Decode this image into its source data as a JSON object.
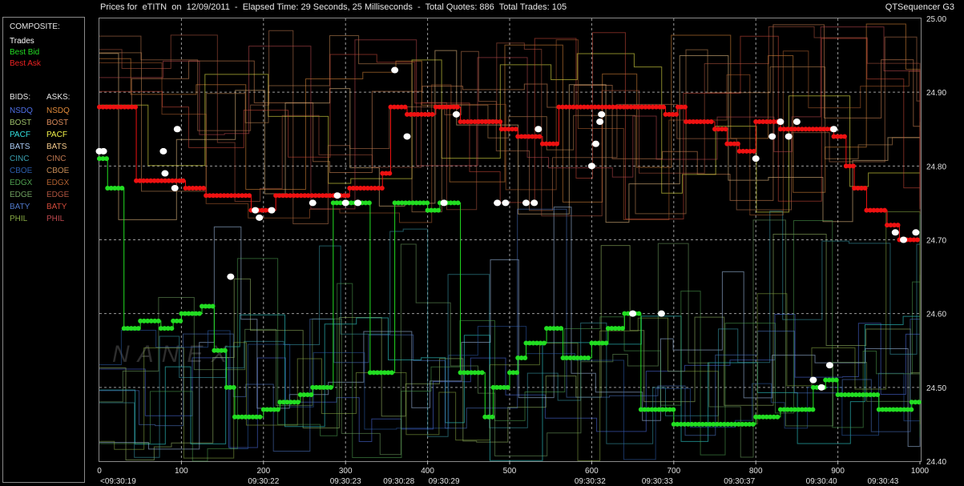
{
  "header": {
    "title": "Prices for  eTITN  on  12/09/2011  -  Elapsed Time: 29 Seconds, 25 Milliseconds  -  Total Quotes: 886  Total Trades: 105",
    "app_name": "QTSequencer G3"
  },
  "legend": {
    "composite_label": "COMPOSITE:",
    "trades_label": "Trades",
    "best_bid_label": "Best Bid",
    "best_ask_label": "Best Ask",
    "bids_header": "BIDS:",
    "asks_header": "ASKS:",
    "exchanges": [
      {
        "name": "NSDQ",
        "bid_color": "#4f6fe6",
        "ask_color": "#e08a3a"
      },
      {
        "name": "BOST",
        "bid_color": "#9cbf6a",
        "ask_color": "#d98a5a"
      },
      {
        "name": "PACF",
        "bid_color": "#33e0e0",
        "ask_color": "#f5f54a"
      },
      {
        "name": "BATS",
        "bid_color": "#a7c7f0",
        "ask_color": "#f4c98a"
      },
      {
        "name": "CINC",
        "bid_color": "#3aa0b0",
        "ask_color": "#c07850"
      },
      {
        "name": "CBOE",
        "bid_color": "#2c5dab",
        "ask_color": "#c48a55"
      },
      {
        "name": "EDGX",
        "bid_color": "#4fa050",
        "ask_color": "#b06030"
      },
      {
        "name": "EDGE",
        "bid_color": "#6fa060",
        "ask_color": "#b05540"
      },
      {
        "name": "BATY",
        "bid_color": "#4f78c8",
        "ask_color": "#d04a3a"
      },
      {
        "name": "PHIL",
        "bid_color": "#88aa44",
        "ask_color": "#c04a50"
      }
    ]
  },
  "colors": {
    "trades": "#ffffff",
    "best_bid": "#22dd22",
    "best_ask": "#ee1111",
    "grid": "#9a9a9a"
  },
  "watermark": "NANEX",
  "chart_data": {
    "type": "scatter",
    "title": "Prices for eTITN on 12/09/2011",
    "xlim": [
      0,
      1000
    ],
    "ylim": [
      24.4,
      25.0
    ],
    "x_ticks": [
      "0",
      "100",
      "200",
      "300",
      "400",
      "500",
      "600",
      "700",
      "800",
      "900",
      "1000"
    ],
    "y_ticks": [
      "25.00",
      "24.90",
      "24.80",
      "24.70",
      "24.60",
      "24.50",
      "24.40"
    ],
    "time_labels": [
      {
        "x": 0,
        "label": "<09:30:19"
      },
      {
        "x": 200,
        "label": "09:30:22"
      },
      {
        "x": 300,
        "label": "09:30:23"
      },
      {
        "x": 365,
        "label": "09:30:28"
      },
      {
        "x": 420,
        "label": "09:30:29"
      },
      {
        "x": 598,
        "label": "09:30:32"
      },
      {
        "x": 680,
        "label": "09:30:33"
      },
      {
        "x": 780,
        "label": "09:30:37"
      },
      {
        "x": 880,
        "label": "09:30:40"
      },
      {
        "x": 955,
        "label": "09:30:43"
      }
    ],
    "best_ask": [
      [
        0,
        24.88
      ],
      [
        45,
        24.88
      ],
      [
        45,
        24.78
      ],
      [
        105,
        24.78
      ],
      [
        105,
        24.77
      ],
      [
        130,
        24.77
      ],
      [
        130,
        24.76
      ],
      [
        185,
        24.76
      ],
      [
        185,
        24.74
      ],
      [
        215,
        24.74
      ],
      [
        215,
        24.76
      ],
      [
        305,
        24.76
      ],
      [
        305,
        24.77
      ],
      [
        345,
        24.77
      ],
      [
        345,
        24.79
      ],
      [
        355,
        24.79
      ],
      [
        355,
        24.88
      ],
      [
        375,
        24.88
      ],
      [
        375,
        24.87
      ],
      [
        410,
        24.87
      ],
      [
        410,
        24.88
      ],
      [
        440,
        24.88
      ],
      [
        440,
        24.86
      ],
      [
        490,
        24.86
      ],
      [
        490,
        24.85
      ],
      [
        510,
        24.85
      ],
      [
        510,
        24.84
      ],
      [
        540,
        24.84
      ],
      [
        540,
        24.83
      ],
      [
        560,
        24.83
      ],
      [
        560,
        24.88
      ],
      [
        690,
        24.88
      ],
      [
        690,
        24.87
      ],
      [
        705,
        24.87
      ],
      [
        705,
        24.88
      ],
      [
        715,
        24.88
      ],
      [
        715,
        24.86
      ],
      [
        750,
        24.86
      ],
      [
        750,
        24.85
      ],
      [
        765,
        24.85
      ],
      [
        765,
        24.83
      ],
      [
        780,
        24.83
      ],
      [
        780,
        24.82
      ],
      [
        800,
        24.82
      ],
      [
        800,
        24.86
      ],
      [
        830,
        24.86
      ],
      [
        830,
        24.85
      ],
      [
        895,
        24.85
      ],
      [
        895,
        24.84
      ],
      [
        910,
        24.84
      ],
      [
        910,
        24.8
      ],
      [
        920,
        24.8
      ],
      [
        920,
        24.77
      ],
      [
        935,
        24.77
      ],
      [
        935,
        24.74
      ],
      [
        960,
        24.74
      ],
      [
        960,
        24.72
      ],
      [
        975,
        24.72
      ],
      [
        975,
        24.7
      ],
      [
        1000,
        24.7
      ]
    ],
    "best_bid": [
      [
        0,
        24.81
      ],
      [
        10,
        24.81
      ],
      [
        10,
        24.77
      ],
      [
        30,
        24.77
      ],
      [
        30,
        24.58
      ],
      [
        50,
        24.58
      ],
      [
        50,
        24.59
      ],
      [
        75,
        24.59
      ],
      [
        75,
        24.58
      ],
      [
        90,
        24.58
      ],
      [
        90,
        24.59
      ],
      [
        100,
        24.59
      ],
      [
        100,
        24.6
      ],
      [
        125,
        24.6
      ],
      [
        125,
        24.61
      ],
      [
        140,
        24.61
      ],
      [
        140,
        24.55
      ],
      [
        155,
        24.55
      ],
      [
        155,
        24.5
      ],
      [
        165,
        24.5
      ],
      [
        165,
        24.46
      ],
      [
        200,
        24.46
      ],
      [
        200,
        24.47
      ],
      [
        220,
        24.47
      ],
      [
        220,
        24.48
      ],
      [
        245,
        24.48
      ],
      [
        245,
        24.49
      ],
      [
        260,
        24.49
      ],
      [
        260,
        24.5
      ],
      [
        285,
        24.5
      ],
      [
        285,
        24.75
      ],
      [
        330,
        24.75
      ],
      [
        330,
        24.52
      ],
      [
        360,
        24.52
      ],
      [
        360,
        24.75
      ],
      [
        400,
        24.75
      ],
      [
        400,
        24.74
      ],
      [
        415,
        24.74
      ],
      [
        415,
        24.75
      ],
      [
        440,
        24.75
      ],
      [
        440,
        24.52
      ],
      [
        470,
        24.52
      ],
      [
        470,
        24.46
      ],
      [
        480,
        24.46
      ],
      [
        480,
        24.5
      ],
      [
        500,
        24.5
      ],
      [
        500,
        24.52
      ],
      [
        510,
        24.52
      ],
      [
        510,
        24.54
      ],
      [
        520,
        24.54
      ],
      [
        520,
        24.56
      ],
      [
        545,
        24.56
      ],
      [
        545,
        24.58
      ],
      [
        565,
        24.58
      ],
      [
        565,
        24.54
      ],
      [
        600,
        24.54
      ],
      [
        600,
        24.56
      ],
      [
        620,
        24.56
      ],
      [
        620,
        24.58
      ],
      [
        640,
        24.58
      ],
      [
        640,
        24.6
      ],
      [
        660,
        24.6
      ],
      [
        660,
        24.47
      ],
      [
        700,
        24.47
      ],
      [
        700,
        24.45
      ],
      [
        800,
        24.45
      ],
      [
        800,
        24.46
      ],
      [
        830,
        24.46
      ],
      [
        830,
        24.47
      ],
      [
        870,
        24.47
      ],
      [
        870,
        24.5
      ],
      [
        885,
        24.5
      ],
      [
        885,
        24.51
      ],
      [
        900,
        24.51
      ],
      [
        900,
        24.49
      ],
      [
        950,
        24.49
      ],
      [
        950,
        24.47
      ],
      [
        990,
        24.47
      ],
      [
        990,
        24.48
      ],
      [
        1000,
        24.48
      ]
    ],
    "trades": [
      [
        0,
        24.82
      ],
      [
        5,
        24.82
      ],
      [
        78,
        24.82
      ],
      [
        80,
        24.79
      ],
      [
        92,
        24.77
      ],
      [
        95,
        24.85
      ],
      [
        160,
        24.65
      ],
      [
        190,
        24.74
      ],
      [
        195,
        24.73
      ],
      [
        210,
        24.74
      ],
      [
        260,
        24.75
      ],
      [
        290,
        24.76
      ],
      [
        300,
        24.75
      ],
      [
        315,
        24.75
      ],
      [
        360,
        24.93
      ],
      [
        375,
        24.84
      ],
      [
        420,
        24.75
      ],
      [
        435,
        24.87
      ],
      [
        485,
        24.75
      ],
      [
        495,
        24.75
      ],
      [
        520,
        24.75
      ],
      [
        530,
        24.75
      ],
      [
        535,
        24.85
      ],
      [
        600,
        24.8
      ],
      [
        605,
        24.83
      ],
      [
        610,
        24.86
      ],
      [
        612,
        24.87
      ],
      [
        650,
        24.6
      ],
      [
        685,
        24.6
      ],
      [
        800,
        24.81
      ],
      [
        820,
        24.84
      ],
      [
        830,
        24.86
      ],
      [
        840,
        24.84
      ],
      [
        850,
        24.86
      ],
      [
        870,
        24.51
      ],
      [
        880,
        24.5
      ],
      [
        890,
        24.53
      ],
      [
        895,
        24.85
      ],
      [
        970,
        24.71
      ],
      [
        980,
        24.7
      ],
      [
        995,
        24.71
      ]
    ]
  }
}
